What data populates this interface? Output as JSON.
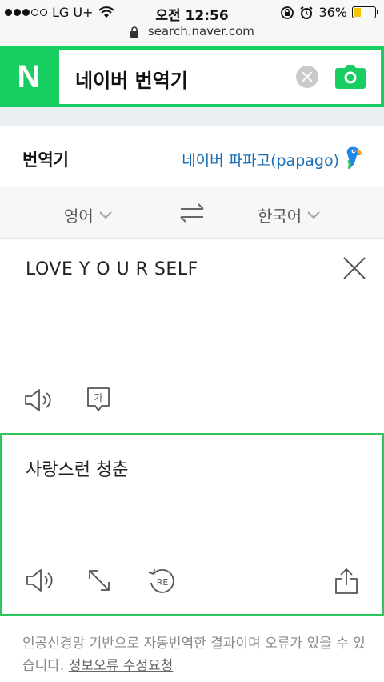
{
  "status_bar": {
    "carrier": "LG U+",
    "time": "오전 12:56",
    "battery": "36%",
    "battery_level": 0.36
  },
  "browser": {
    "url": "search.naver.com"
  },
  "search": {
    "logo": "N",
    "query": "네이버 번역기"
  },
  "translator": {
    "title": "번역기",
    "papago_link": "네이버 파파고(papago)",
    "source_lang": "영어",
    "target_lang": "한국어",
    "source_text": "LOVE Y O U R SELF",
    "hanja_label": "가",
    "result_text": "사랑스런 청춘",
    "replay_label": "RE"
  },
  "notice": {
    "text": "인공신경망 기반으로 자동번역한 결과이며 오류가 있을 수 있습니다. ",
    "link": "정보오류 수정요청"
  },
  "colors": {
    "naver_green": "#19ce60",
    "result_border": "#2ec55e",
    "link_blue": "#1a6fb6"
  }
}
